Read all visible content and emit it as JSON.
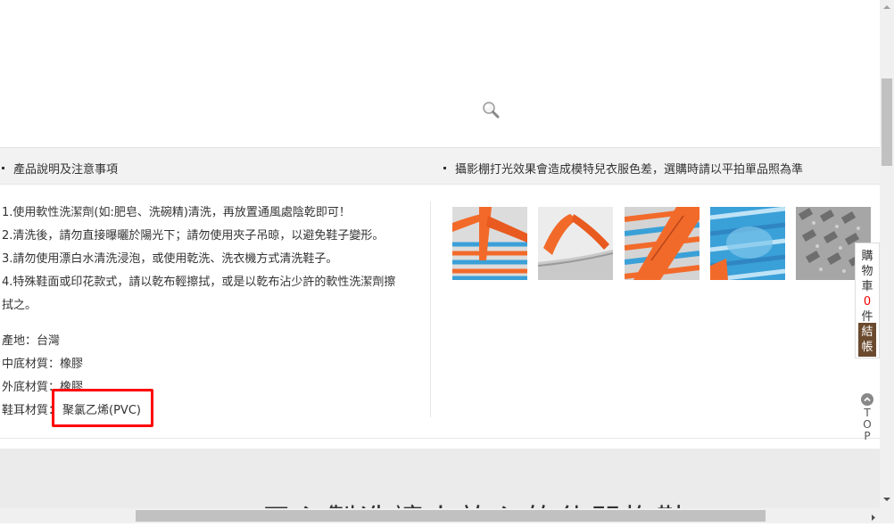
{
  "info_bar": {
    "left_header": "產品說明及注意事項",
    "right_header": "攝影棚打光效果會造成模特兒衣服色差，選購時請以平拍單品照為準"
  },
  "care_instructions": [
    "1.使用軟性洗潔劑(如:肥皂、洗碗精)清洗，再放置通風處陰乾即可！",
    "2.清洗後，請勿直接曝曬於陽光下；請勿使用夾子吊晾，以避免鞋子變形。",
    "3.請勿使用漂白水清洗浸泡，或使用乾洗、洗衣機方式清洗鞋子。",
    "4.特殊鞋面或印花款式，請以乾布輕擦拭，或是以乾布沾少許的軟性洗潔劑擦",
    "拭之。"
  ],
  "specs": {
    "origin": "產地：台灣",
    "midsole": "中底材質：橡膠",
    "outsole": "外底材質：橡膠",
    "strap_label": "鞋耳材質：",
    "strap_value": "聚氯乙烯(PVC)"
  },
  "thumbnails": [
    {
      "name": "thumb-strap-closeup",
      "colors": [
        "#3aa0d8",
        "#f26a2a",
        "#dcdcdc"
      ]
    },
    {
      "name": "thumb-strap-side",
      "colors": [
        "#f26a2a",
        "#e8e8e8",
        "#c9c9c9"
      ]
    },
    {
      "name": "thumb-made-in-taiwan",
      "colors": [
        "#f26a2a",
        "#3aa0d8",
        "#cfcfcf"
      ]
    },
    {
      "name": "thumb-sole-logo",
      "colors": [
        "#2f9ad6",
        "#9fd3ef",
        "#f26a2a"
      ]
    },
    {
      "name": "thumb-tread-pattern",
      "colors": [
        "#9a9a9a",
        "#6e6e6e",
        "#c4c4c4"
      ]
    }
  ],
  "cart": {
    "chars": [
      "購",
      "物",
      "車"
    ],
    "count": "0",
    "unit": "件",
    "checkout_chars": [
      "結",
      "帳"
    ]
  },
  "top_button": {
    "chars": [
      "T",
      "O",
      "P"
    ]
  },
  "bottom_banner": {
    "title": "用心製造讓人放心的休閒拖鞋"
  },
  "colors": {
    "highlight": "#ff0000",
    "cart_count": "#e00000",
    "checkout_bg": "#6b4a2e"
  }
}
